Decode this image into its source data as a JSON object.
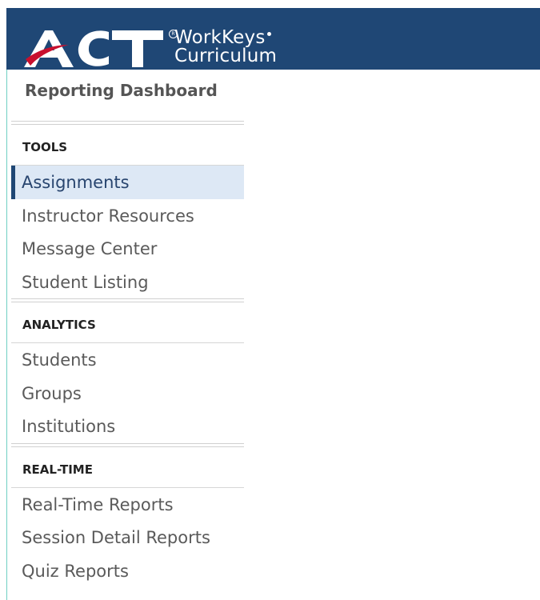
{
  "brand": {
    "logo_text": "ACT",
    "product_line1": "WorkKeys",
    "product_line2": "Curriculum",
    "registered_mark": "R",
    "header_color": "#1f4775"
  },
  "page_title": "Reporting Dashboard",
  "sidebar": {
    "sections": [
      {
        "heading": "TOOLS",
        "items": [
          {
            "label": "Assignments",
            "active": true
          },
          {
            "label": "Instructor Resources",
            "active": false
          },
          {
            "label": "Message Center",
            "active": false
          },
          {
            "label": "Student Listing",
            "active": false
          }
        ]
      },
      {
        "heading": "ANALYTICS",
        "items": [
          {
            "label": "Students",
            "active": false
          },
          {
            "label": "Groups",
            "active": false
          },
          {
            "label": "Institutions",
            "active": false
          }
        ]
      },
      {
        "heading": "REAL-TIME",
        "items": [
          {
            "label": "Real-Time Reports",
            "active": false
          },
          {
            "label": "Session Detail Reports",
            "active": false
          },
          {
            "label": "Quiz Reports",
            "active": false
          }
        ]
      }
    ],
    "active_color": "#dde8f5",
    "active_bar_color": "#1f4775"
  }
}
